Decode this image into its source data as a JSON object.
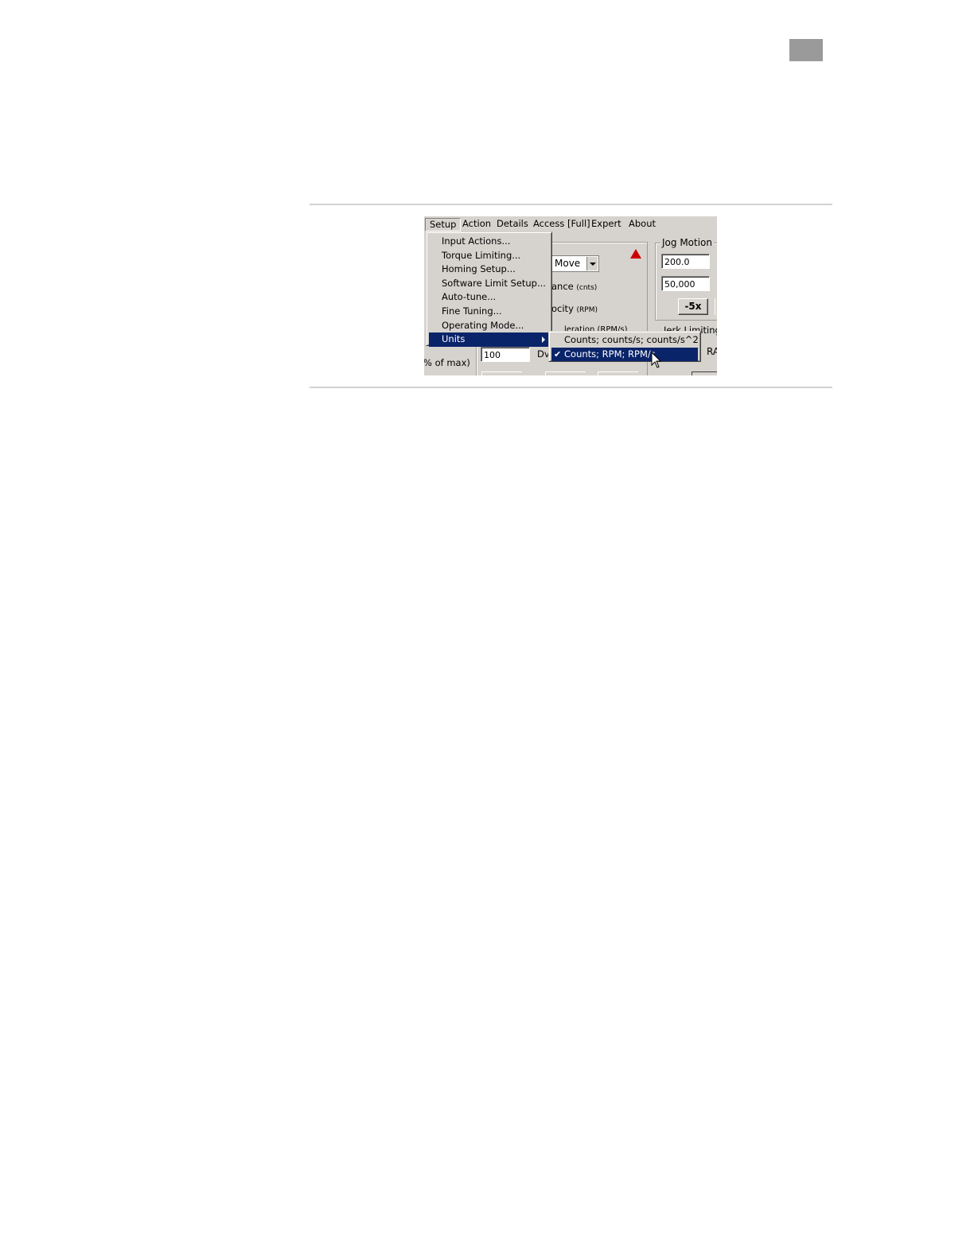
{
  "menubar": {
    "items": [
      "Setup",
      "Action",
      "Details",
      "Access [Full]",
      "Expert",
      "About"
    ]
  },
  "setup_menu": {
    "items": [
      "Input Actions...",
      "Torque Limiting...",
      "Homing Setup...",
      "Software Limit Setup...",
      "Auto-tune...",
      "Fine Tuning...",
      "Operating Mode...",
      "Units"
    ]
  },
  "units_submenu": {
    "items": [
      "Counts; counts/s; counts/s^2",
      "Counts; RPM; RPM/s"
    ],
    "checked": "Counts; RPM; RPM/s"
  },
  "background": {
    "move_type": "Move",
    "distance_label": "ance",
    "distance_unit": "(cnts)",
    "velocity_label": "ocity",
    "velocity_unit": "(RPM)",
    "accel_partial": "leration (RPM/s)",
    "field_100": "100",
    "dv_label": "Dv",
    "pct_max": "% of max)",
    "jog_title": "Jog Motion",
    "jog_field_1": "200.0",
    "jog_field_2": "50,000",
    "jog_button": "-5x",
    "jerk_label": "Jerk Limiting",
    "ra_label": "RA"
  },
  "colors": {
    "highlight": "#0a246a",
    "face": "#d6d3ce",
    "warning": "#cc0000"
  }
}
